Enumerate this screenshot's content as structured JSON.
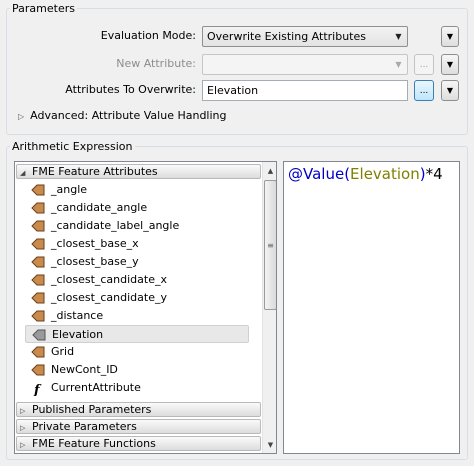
{
  "parameters": {
    "title": "Parameters",
    "evaluation_mode": {
      "label": "Evaluation Mode:",
      "value": "Overwrite Existing Attributes"
    },
    "new_attribute": {
      "label": "New Attribute:",
      "value": ""
    },
    "attributes_to_overwrite": {
      "label": "Attributes To Overwrite:",
      "value": "Elevation"
    },
    "advanced_label": "Advanced: Attribute Value Handling",
    "ellipsis": "...",
    "icons": {
      "combo_arrow": "chevron-down-icon",
      "menu": "triangle-down-icon",
      "expand": "triangle-right-icon"
    }
  },
  "expression": {
    "title": "Arithmetic Expression",
    "sections": [
      {
        "label": "FME Feature Attributes",
        "expanded": true
      },
      {
        "label": "Published Parameters",
        "expanded": false
      },
      {
        "label": "Private Parameters",
        "expanded": false
      },
      {
        "label": "FME Feature Functions",
        "expanded": false
      }
    ],
    "attributes": [
      {
        "label": "_angle",
        "icon": "attribute-icon"
      },
      {
        "label": "_candidate_angle",
        "icon": "attribute-icon"
      },
      {
        "label": "_candidate_label_angle",
        "icon": "attribute-icon"
      },
      {
        "label": "_closest_base_x",
        "icon": "attribute-icon"
      },
      {
        "label": "_closest_base_y",
        "icon": "attribute-icon"
      },
      {
        "label": "_closest_candidate_x",
        "icon": "attribute-icon"
      },
      {
        "label": "_closest_candidate_y",
        "icon": "attribute-icon"
      },
      {
        "label": "_distance",
        "icon": "attribute-icon"
      },
      {
        "label": "Elevation",
        "icon": "attribute-icon",
        "selected": true
      },
      {
        "label": "Grid",
        "icon": "attribute-icon"
      },
      {
        "label": "NewCont_ID",
        "icon": "attribute-icon"
      },
      {
        "label": "CurrentAttribute",
        "icon": "function-icon"
      }
    ],
    "editor": {
      "fn_open": "@Value(",
      "attr": "Elevation",
      "fn_close": ")",
      "rest": "*4"
    },
    "colors": {
      "function": "#0000c8",
      "attribute": "#808000"
    }
  }
}
